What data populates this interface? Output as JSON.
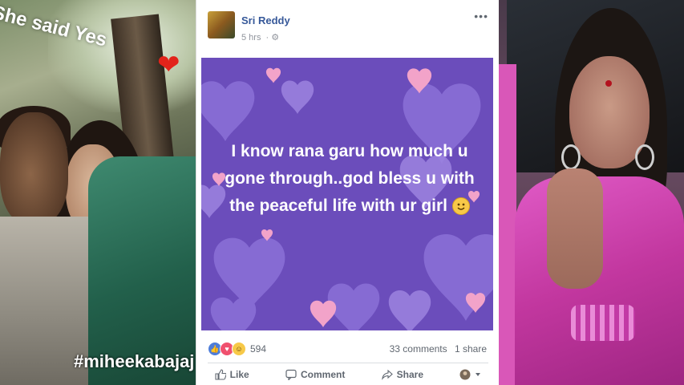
{
  "left_photo": {
    "caption": "She said Yes",
    "heart_emoji": "❤",
    "hashtag": "#miheekabajaj"
  },
  "post": {
    "author": "Sri Reddy",
    "time": "5 hrs",
    "privacy_icon": "settings-globe-icon",
    "more_label": "•••",
    "message": "I know rana garu how much u gone through..god bless u with the peaceful life with ur girl",
    "message_emoji": "slightly-smiling-face",
    "card_color": "#6b4dbb",
    "reactions": {
      "icons": [
        "like",
        "love",
        "haha"
      ],
      "count": "594"
    },
    "comments": "33 comments",
    "shares": "1 share",
    "actions": {
      "like": "Like",
      "comment": "Comment",
      "share": "Share"
    }
  },
  "colors": {
    "facebook_link": "#365899",
    "muted_text": "#606770",
    "like_blue": "#4e7dd9",
    "love_red": "#f0506e",
    "haha_yellow": "#f7c948"
  }
}
